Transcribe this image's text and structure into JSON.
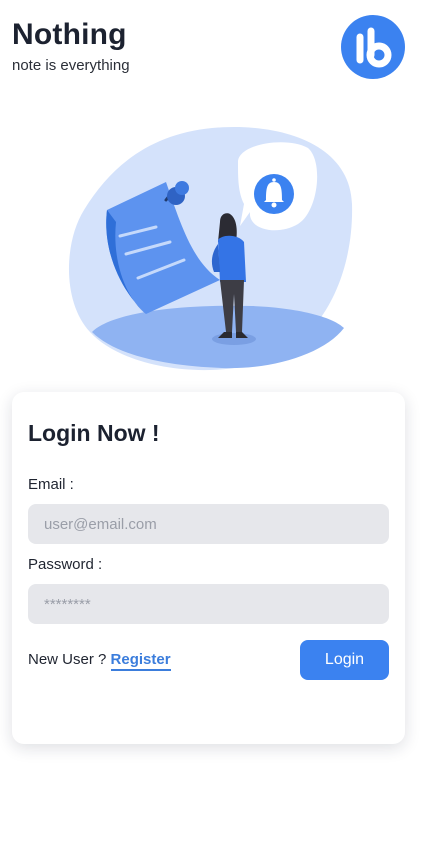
{
  "header": {
    "title": "Nothing",
    "subtitle": "note is everything"
  },
  "icons": {
    "logo": "brand-logo-icon",
    "hero": "pinned-note-notification-illustration",
    "bell": "bell-icon"
  },
  "colors": {
    "accent": "#3b82f0",
    "link": "#3b7ddc",
    "field_bg": "#e6e7eb",
    "illustration_bg": "#d4e2fb"
  },
  "login": {
    "title": "Login Now !",
    "email_label": "Email :",
    "email_placeholder": "user@email.com",
    "password_label": "Password :",
    "password_placeholder": "********",
    "new_user_text": "New User ?",
    "register_label": "Register",
    "login_button": "Login"
  }
}
